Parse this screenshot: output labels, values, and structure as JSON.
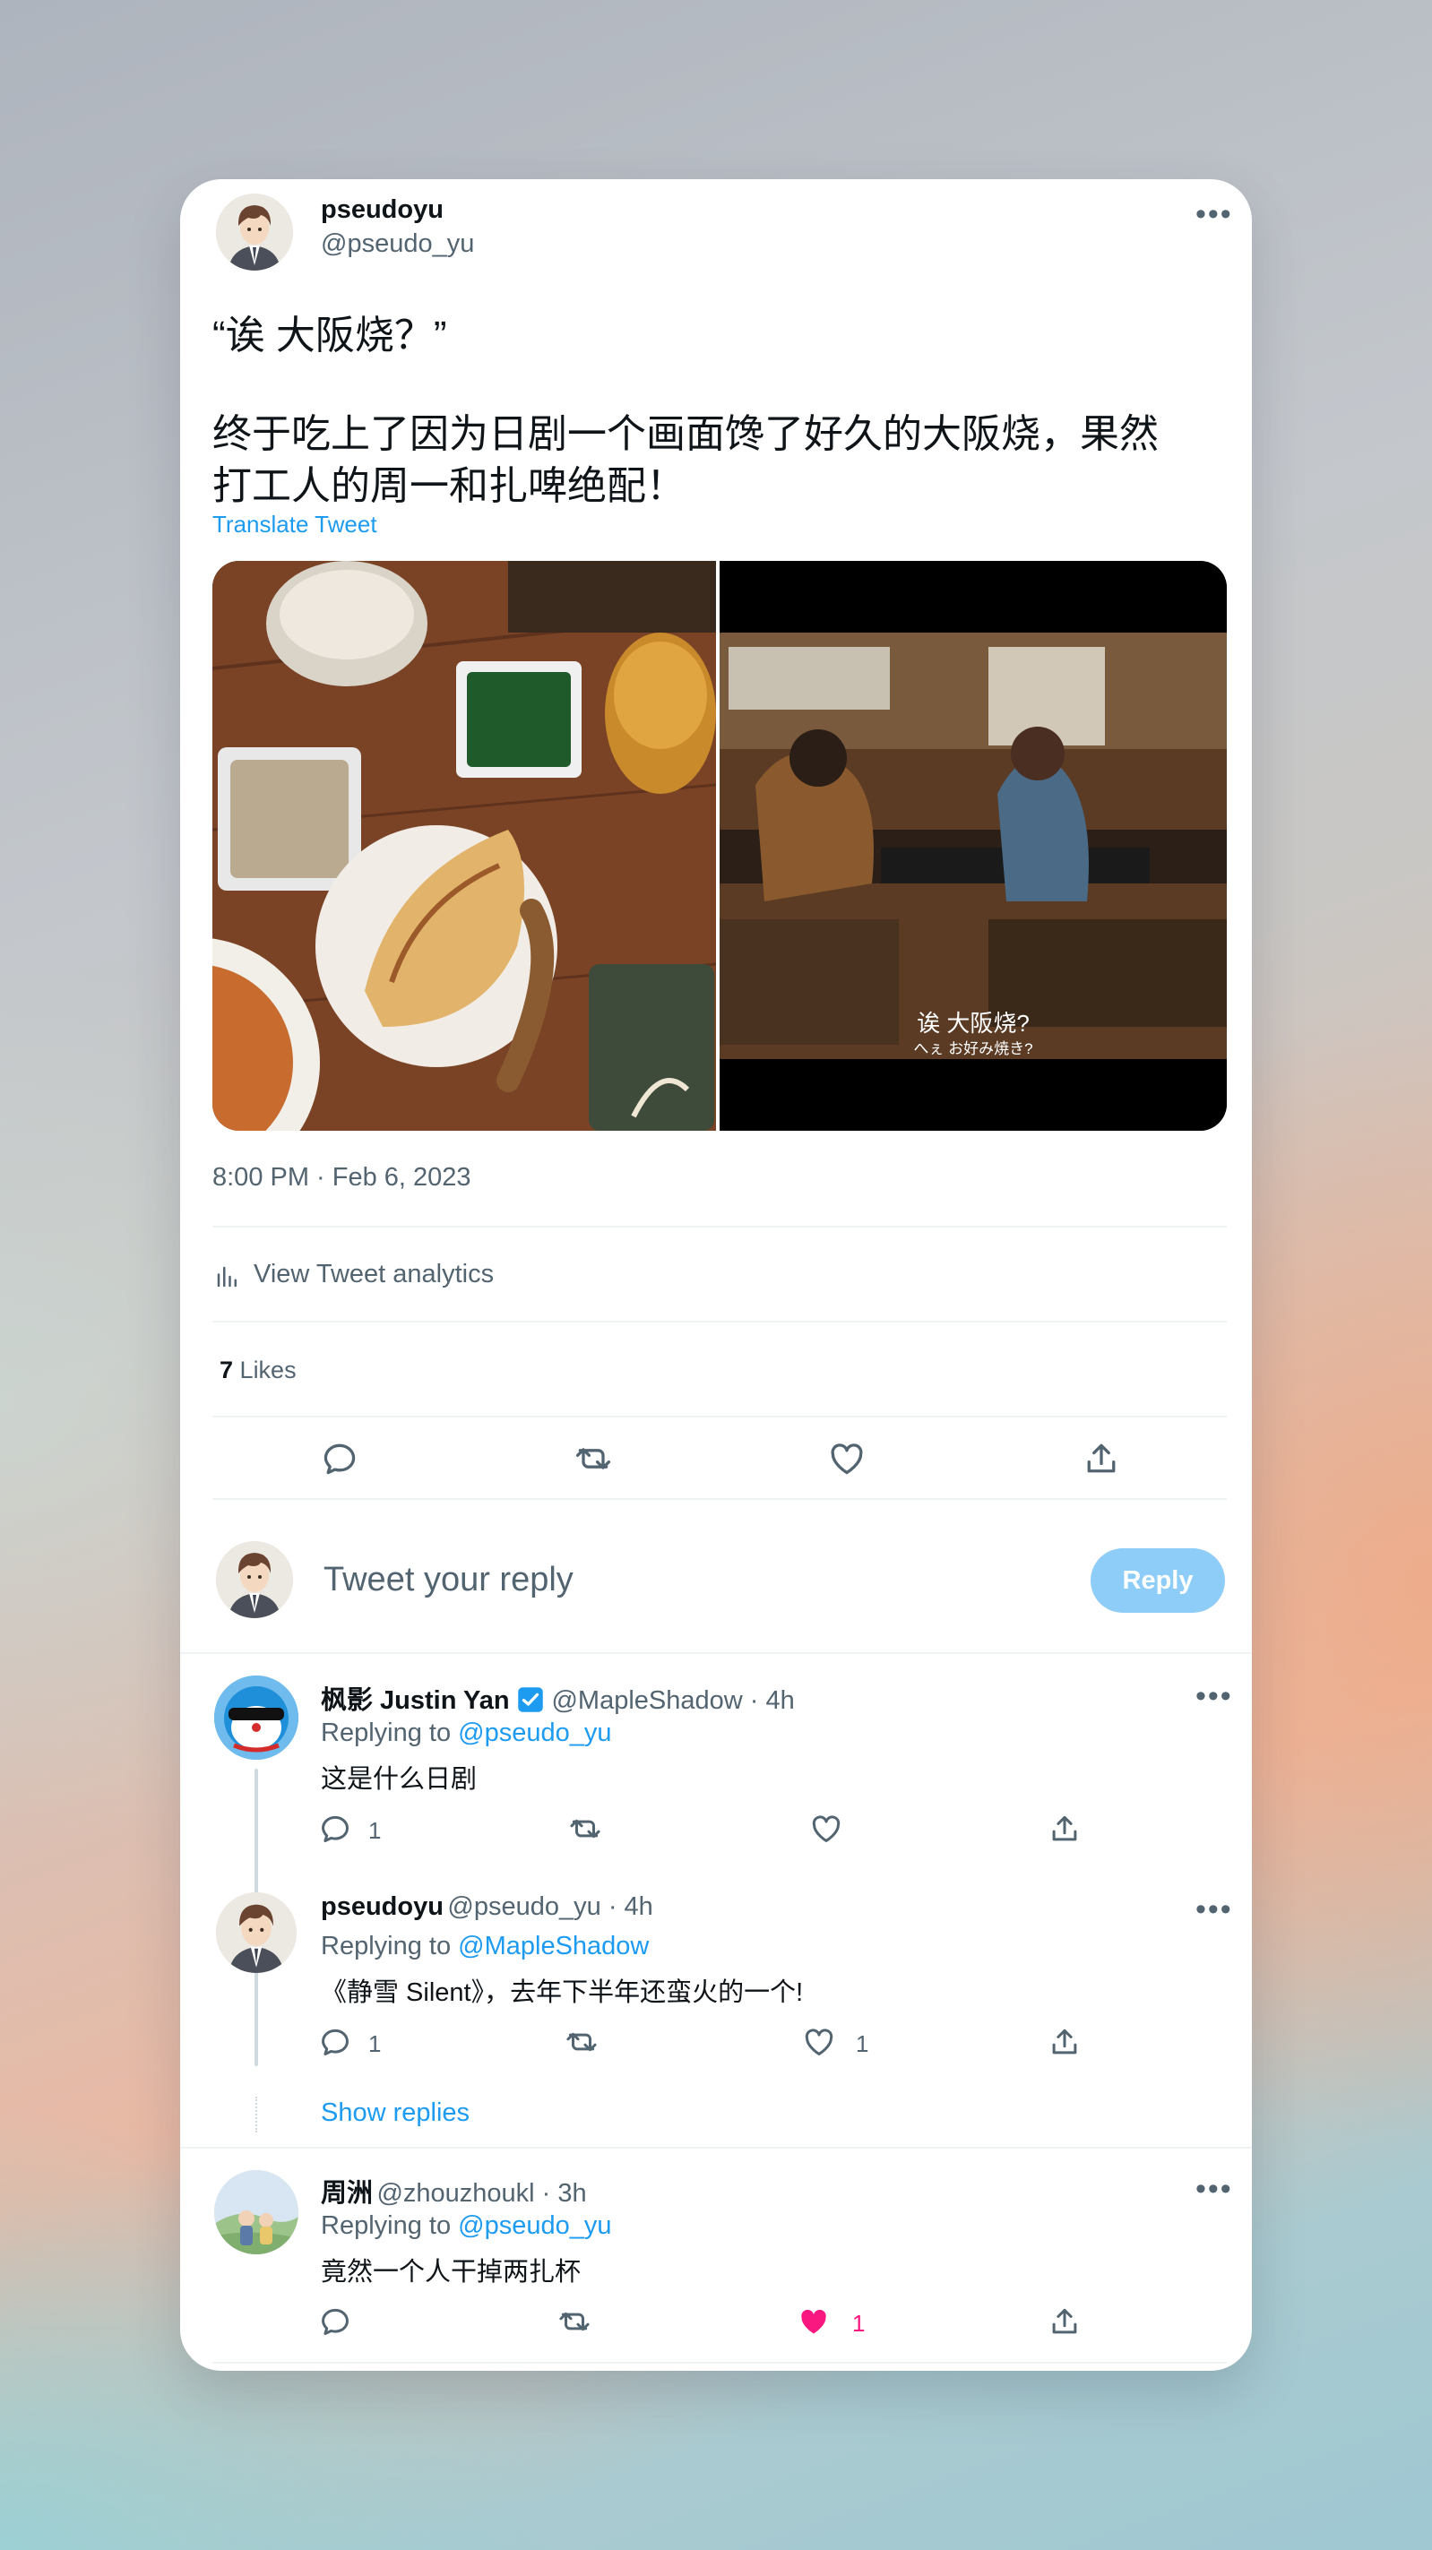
{
  "tweet": {
    "author_name": "pseudoyu",
    "author_handle": "@pseudo_yu",
    "text_line1": "“诶 大阪烧？”",
    "text_line2": "终于吃上了因为日剧一个画面馋了好久的大阪烧，果然",
    "text_line3": "打工人的周一和扎啤绝配！",
    "translate_label": "Translate Tweet",
    "image_subtitle_zh": "诶 大阪烧?",
    "image_subtitle_ja": "へぇ お好み焼き?",
    "timestamp": "8:00 PM · Feb 6, 2023",
    "analytics_label": "View Tweet analytics",
    "likes_count": "7",
    "likes_label": "Likes"
  },
  "composer": {
    "placeholder": "Tweet your reply",
    "reply_button": "Reply"
  },
  "replies": [
    {
      "name": "枫影 Justin Yan",
      "handle": "@MapleShadow · 4h",
      "replying_prefix": "Replying to",
      "replying_to": "@pseudo_yu",
      "text": "这是什么日剧",
      "reply_count": "1",
      "like_count": ""
    },
    {
      "name": "pseudoyu",
      "handle": "@pseudo_yu · 4h",
      "replying_prefix": "Replying to",
      "replying_to": "@MapleShadow",
      "text": "《静雪 Silent》，去年下半年还蛮火的一个!",
      "reply_count": "1",
      "like_count": "1"
    },
    {
      "name": "周洲",
      "handle": "@zhouzhoukl · 3h",
      "replying_prefix": "Replying to",
      "replying_to": "@pseudo_yu",
      "text": "竟然一个人干掉两扎杯",
      "reply_count": "",
      "like_count": "1"
    }
  ],
  "show_replies_label": "Show replies",
  "colors": {
    "accent": "#1d9bf0",
    "reply_button_bg": "#8ecdf8",
    "like_active": "#f91880",
    "secondary_text": "#536471"
  }
}
